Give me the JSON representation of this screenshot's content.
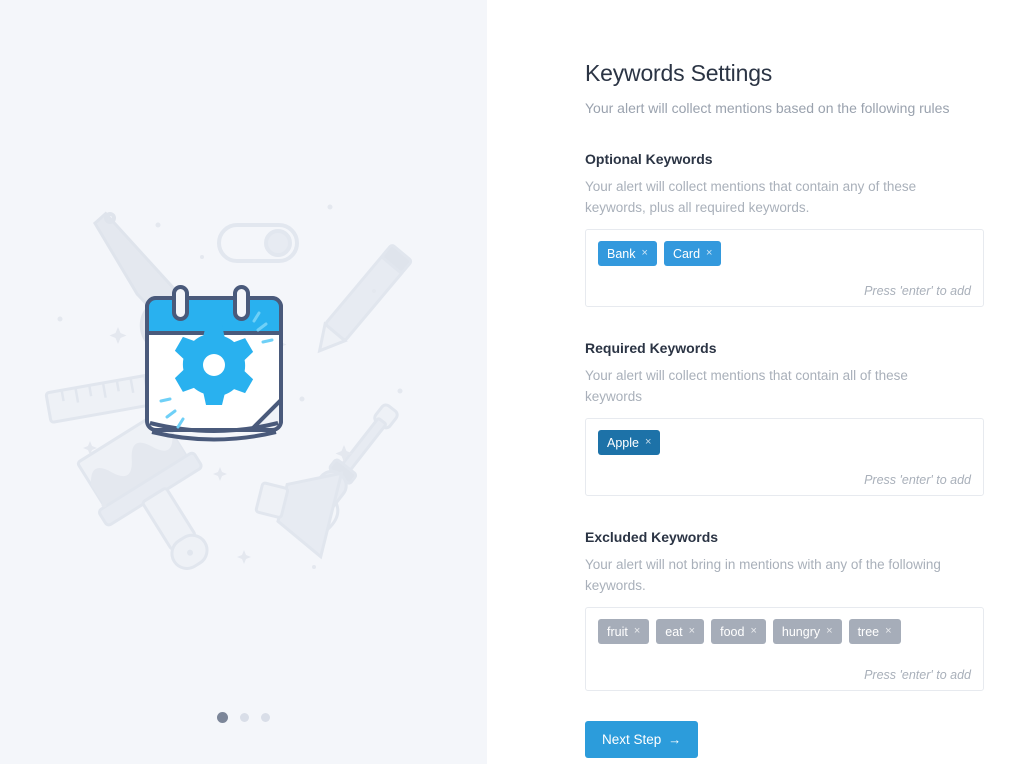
{
  "header": {
    "title": "Keywords Settings",
    "subtitle": "Your alert will collect mentions based on the following rules"
  },
  "sections": [
    {
      "id": "optional",
      "title": "Optional Keywords",
      "description": "Your alert will collect mentions that contain any of these keywords, plus all required keywords.",
      "tags": [
        "Bank",
        "Card"
      ],
      "hint": "Press 'enter' to add",
      "tag_color": "#3399dd"
    },
    {
      "id": "required",
      "title": "Required Keywords",
      "description": "Your alert will collect mentions that contain all of these keywords",
      "tags": [
        "Apple"
      ],
      "hint": "Press 'enter' to add",
      "tag_color": "#1d72a8"
    },
    {
      "id": "excluded",
      "title": "Excluded Keywords",
      "description": "Your alert will not bring in mentions with any of the following keywords.",
      "tags": [
        "fruit",
        "eat",
        "food",
        "hungry",
        "tree"
      ],
      "hint": "Press 'enter' to add",
      "tag_color": "#a6adb9"
    }
  ],
  "tag_remove_glyph": "×",
  "actions": {
    "next_label": "Next Step",
    "next_arrow": "→",
    "next_color": "#2c9cdb"
  },
  "illustration": {
    "name": "calendar-settings-illustration",
    "accent_color": "#29b1ef",
    "outline_color": "#4a5a7b",
    "tool_color": "#e4e8ef",
    "background": "#f4f6fa",
    "items": [
      "calendar-gear",
      "wrench-icon",
      "toggle-switch-icon",
      "pencil-icon",
      "ruler-icon",
      "screwdriver-icon",
      "paintbrush-icon",
      "megaphone-icon"
    ]
  },
  "pagination": {
    "total": 3,
    "active_index": 0
  }
}
